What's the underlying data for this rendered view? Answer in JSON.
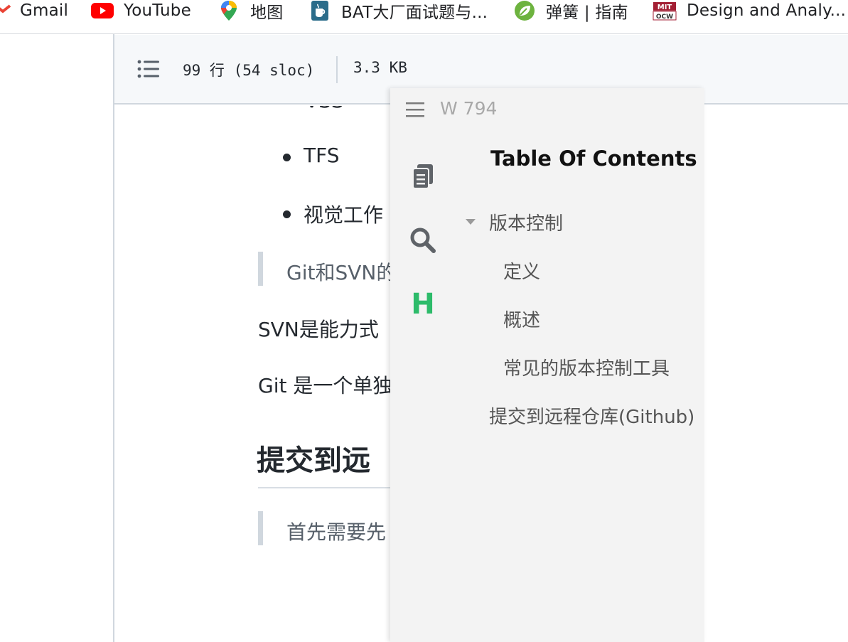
{
  "bookmarks": [
    {
      "label": "Gmail",
      "icon": "gmail-icon"
    },
    {
      "label": "YouTube",
      "icon": "youtube-icon"
    },
    {
      "label": "地图",
      "icon": "maps-pin-icon"
    },
    {
      "label": "BAT大厂面试题与...",
      "icon": "java-cup-icon"
    },
    {
      "label": "弹簧 | 指南",
      "icon": "spring-leaf-icon"
    },
    {
      "label": "Design and Analy...",
      "icon": "mit-ocw-icon"
    }
  ],
  "file_header": {
    "lines": "99 行 (54 sloc)",
    "size": "3.3 KB"
  },
  "markdown": {
    "partial_item": "VSS",
    "items": [
      "TFS",
      "视觉工作"
    ],
    "quote1": "Git和SVN的",
    "para1": "SVN是能力式",
    "para2": "Git 是一个单独",
    "heading": "提交到远",
    "quote2": "首先需要先"
  },
  "sidebar": {
    "word_count": "W 794",
    "toc_title": "Table Of Contents",
    "toc": [
      {
        "label": "版本控制",
        "level": 1,
        "expanded": true
      },
      {
        "label": "定义",
        "level": 2
      },
      {
        "label": "概述",
        "level": 2
      },
      {
        "label": "常见的版本控制工具",
        "level": 2
      },
      {
        "label": "提交到远程仓库(Github)",
        "level": 1
      }
    ],
    "tools": [
      "files-icon",
      "search-icon",
      "heading-icon"
    ],
    "heading_tool_label": "H"
  },
  "colors": {
    "accent_green": "#2dbb6a",
    "youtube_red": "#ff0000",
    "gmail_red": "#ea4335"
  }
}
